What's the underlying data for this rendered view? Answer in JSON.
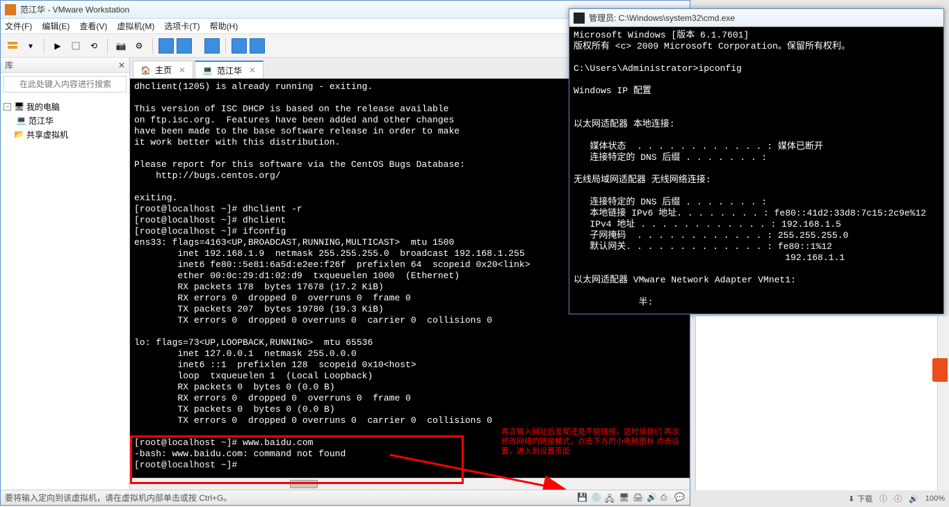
{
  "vmw": {
    "title": "范江华 - VMware Workstation",
    "menu": {
      "file": "文件(F)",
      "edit": "编辑(E)",
      "view": "查看(V)",
      "vm": "虚拟机(M)",
      "tabs": "选项卡(T)",
      "help": "帮助(H)"
    },
    "lib_hdr": "库",
    "search_ph": "在此处键入内容进行搜索",
    "tree": {
      "root": "我的电脑",
      "child1": "范江华",
      "child2": "共享虚拟机"
    },
    "tabs": {
      "home": "主页",
      "vm": "范江华"
    },
    "status": "要将输入定向到该虚拟机，请在虚拟机内部单击或按 Ctrl+G。"
  },
  "console_lines": [
    "dhclient(1205) is already running - exiting.",
    "",
    "This version of ISC DHCP is based on the release available",
    "on ftp.isc.org.  Features have been added and other changes",
    "have been made to the base software release in order to make",
    "it work better with this distribution.",
    "",
    "Please report for this software via the CentOS Bugs Database:",
    "    http://bugs.centos.org/",
    "",
    "exiting.",
    "[root@localhost ~]# dhclient -r",
    "[root@localhost ~]# dhclient",
    "[root@localhost ~]# ifconfig",
    "ens33: flags=4163<UP,BROADCAST,RUNNING,MULTICAST>  mtu 1500",
    "        inet 192.168.1.9  netmask 255.255.255.0  broadcast 192.168.1.255",
    "        inet6 fe80::5e81:6a5d:e2ee:f26f  prefixlen 64  scopeid 0x20<link>",
    "        ether 00:0c:29:d1:02:d9  txqueuelen 1000  (Ethernet)",
    "        RX packets 178  bytes 17678 (17.2 KiB)",
    "        RX errors 0  dropped 0  overruns 0  frame 0",
    "        TX packets 207  bytes 19780 (19.3 KiB)",
    "        TX errors 0  dropped 0 overruns 0  carrier 0  collisions 0",
    "",
    "lo: flags=73<UP,LOOPBACK,RUNNING>  mtu 65536",
    "        inet 127.0.0.1  netmask 255.0.0.0",
    "        inet6 ::1  prefixlen 128  scopeid 0x10<host>",
    "        loop  txqueuelen 1  (Local Loopback)",
    "        RX packets 0  bytes 0 (0.0 B)",
    "        RX errors 0  dropped 0  overruns 0  frame 0",
    "        TX packets 0  bytes 0 (0.0 B)",
    "        TX errors 0  dropped 0 overruns 0  carrier 0  collisions 0",
    "",
    "[root@localhost ~]# www.baidu.com",
    "-bash: www.baidu.com: command not found",
    "[root@localhost ~]# "
  ],
  "annotation": "再次输入网址后发现还是不能链接，这时候我们\n再次修改网络的链接模式，点击下方的小电脑图标\n点击设置，进入到设置页面",
  "cmd": {
    "title": "管理员: C:\\Windows\\system32\\cmd.exe",
    "lines": [
      "Microsoft Windows [版本 6.1.7601]",
      "版权所有 <c> 2009 Microsoft Corporation。保留所有权利。",
      "",
      "C:\\Users\\Administrator>ipconfig",
      "",
      "Windows IP 配置",
      "",
      "",
      "以太网适配器 本地连接:",
      "",
      "   媒体状态  . . . . . . . . . . . . : 媒体已断开",
      "   连接特定的 DNS 后缀 . . . . . . . :",
      "",
      "无线局域网适配器 无线网络连接:",
      "",
      "   连接特定的 DNS 后缀 . . . . . . . :",
      "   本地链接 IPv6 地址. . . . . . . . : fe80::41d2:33d8:7c15:2c9e%12",
      "   IPv4 地址 . . . . . . . . . . . . : 192.168.1.5",
      "   子网掩码  . . . . . . . . . . . . : 255.255.255.0",
      "   默认网关. . . . . . . . . . . . . : fe80::1%12",
      "                                       192.168.1.1",
      "",
      "以太网适配器 VMware Network Adapter VMnet1:",
      "",
      "            半:"
    ]
  },
  "tray": {
    "download": "下载",
    "speed": "ⓘ",
    "vol": "🔊",
    "pct": "100%"
  }
}
